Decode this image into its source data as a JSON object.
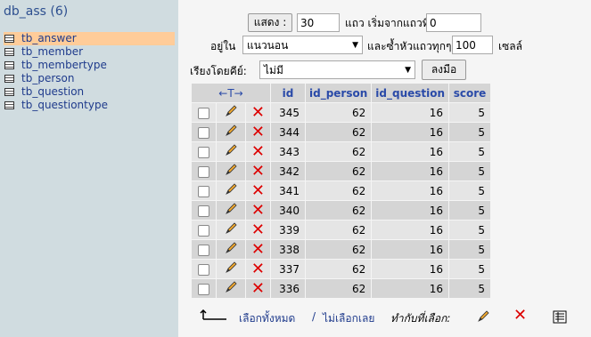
{
  "sidebar": {
    "db_title": "db_ass (6)",
    "tables": [
      {
        "name": "tb_answer",
        "active": true
      },
      {
        "name": "tb_member",
        "active": false
      },
      {
        "name": "tb_membertype",
        "active": false
      },
      {
        "name": "tb_person",
        "active": false
      },
      {
        "name": "tb_question",
        "active": false
      },
      {
        "name": "tb_questiontype",
        "active": false
      }
    ]
  },
  "controls": {
    "show_button": "แสดง :",
    "rows_value": "30",
    "rows_label": "แถว เริ่มจากแถวที่",
    "start_value": "0",
    "mode_label": "อยู่ใน",
    "mode_value": "แนวนอน",
    "repeat_label": "และซ้ำหัวแถวทุกๆ",
    "repeat_value": "100",
    "cells_label": "เซลล์",
    "sort_label": "เรียงโดยคีย์:",
    "sort_value": "ไม่มี",
    "go_button": "ลงมือ"
  },
  "table": {
    "sort_arrows": "←T→",
    "columns": [
      "id",
      "id_person",
      "id_question",
      "score"
    ],
    "rows": [
      [
        "345",
        "62",
        "16",
        "5"
      ],
      [
        "344",
        "62",
        "16",
        "5"
      ],
      [
        "343",
        "62",
        "16",
        "5"
      ],
      [
        "342",
        "62",
        "16",
        "5"
      ],
      [
        "341",
        "62",
        "16",
        "5"
      ],
      [
        "340",
        "62",
        "16",
        "5"
      ],
      [
        "339",
        "62",
        "16",
        "5"
      ],
      [
        "338",
        "62",
        "16",
        "5"
      ],
      [
        "337",
        "62",
        "16",
        "5"
      ],
      [
        "336",
        "62",
        "16",
        "5"
      ]
    ]
  },
  "bottom": {
    "check_all": "เลือกทั้งหมด",
    "separator": "/",
    "uncheck_all": "ไม่เลือกเลย",
    "with_selected": "ทำกับที่เลือก:"
  },
  "colors": {
    "sidebar_bg": "#d0dce0",
    "active_item": "#ffcc99",
    "link": "#1f3b8c",
    "header_text": "#2a4aa8",
    "delete": "#dd0000"
  }
}
